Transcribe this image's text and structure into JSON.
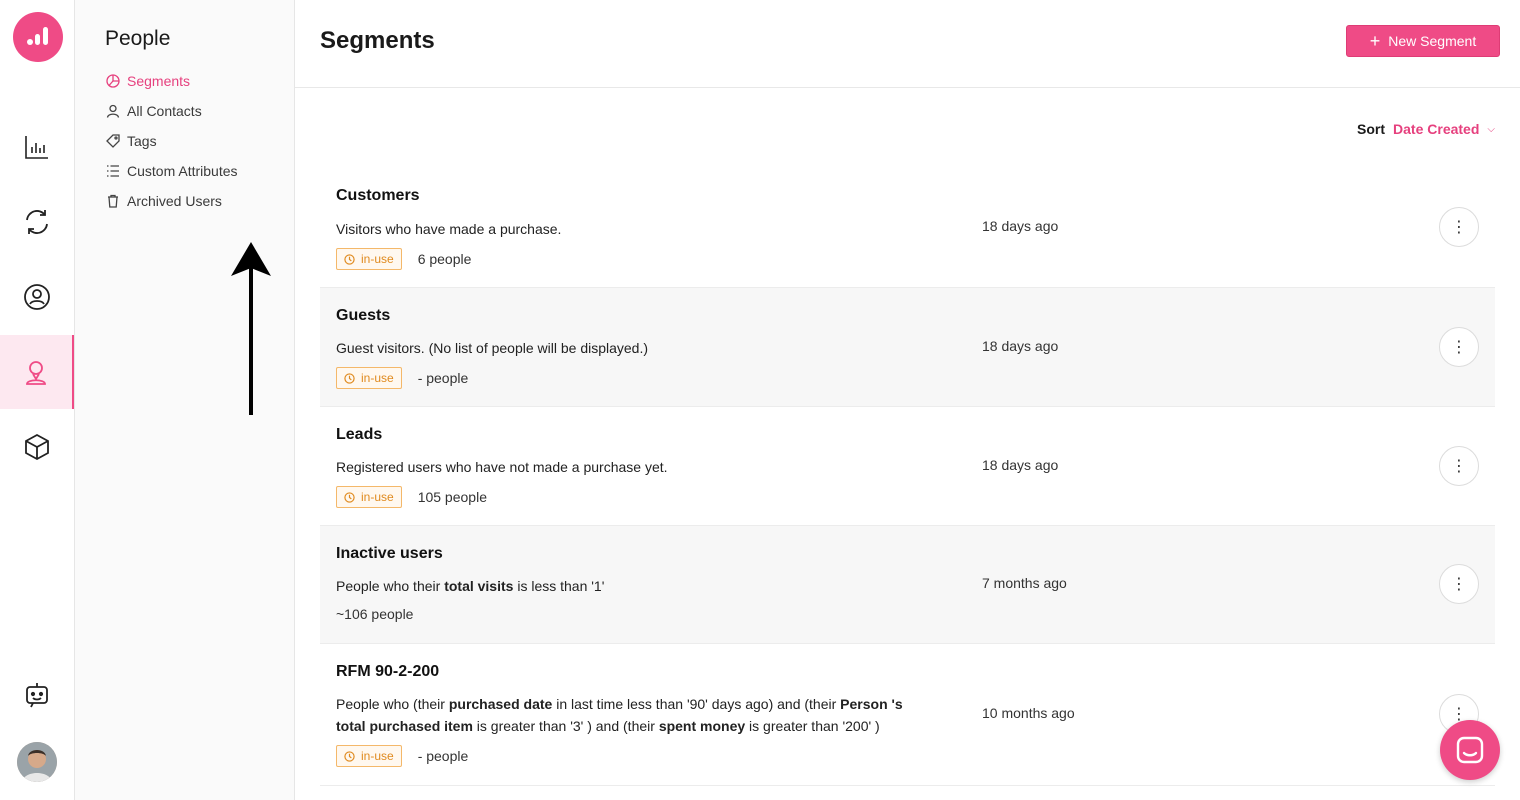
{
  "brand": {
    "accent": "#ef4b86",
    "accent_text": "#e6407e",
    "badge_color": "#e08a1e"
  },
  "rail": {
    "items": [
      {
        "icon": "bar-chart-icon"
      },
      {
        "icon": "refresh-icon"
      },
      {
        "icon": "user-circle-icon"
      },
      {
        "icon": "person-location-icon",
        "active": true
      },
      {
        "icon": "cube-icon"
      }
    ],
    "bottom": [
      {
        "icon": "bot-icon"
      },
      {
        "icon": "avatar"
      }
    ]
  },
  "subnav": {
    "title": "People",
    "items": [
      {
        "label": "Segments",
        "icon": "pie-chart-icon",
        "active": true
      },
      {
        "label": "All Contacts",
        "icon": "user-icon"
      },
      {
        "label": "Tags",
        "icon": "tag-icon"
      },
      {
        "label": "Custom Attributes",
        "icon": "list-icon"
      },
      {
        "label": "Archived Users",
        "icon": "trash-icon"
      }
    ]
  },
  "main": {
    "title": "Segments",
    "new_button": "New Segment",
    "sort_label": "Sort",
    "sort_value": "Date Created"
  },
  "segments": [
    {
      "name": "Customers",
      "desc_html": "Visitors who have made a purchase.",
      "badge": "in-use",
      "people": "6 people",
      "date": "18 days ago"
    },
    {
      "name": "Guests",
      "desc_html": "Guest visitors. (No list of people will be displayed.)",
      "badge": "in-use",
      "people": "- people",
      "date": "18 days ago"
    },
    {
      "name": "Leads",
      "desc_html": "Registered users who have not made a purchase yet.",
      "badge": "in-use",
      "people": "105 people",
      "date": "18 days ago"
    },
    {
      "name": "Inactive users",
      "desc_html": "People who their <b>total visits</b> is less than '1'",
      "badge": "",
      "people": "~106 people",
      "date": "7 months ago"
    },
    {
      "name": "RFM 90-2-200",
      "desc_html": "People who (their <b>purchased date</b> in last time less than '90' days ago) and (their <b>Person 's total purchased item</b> is greater than '3' ) and (their <b>spent money</b> is greater than '200' )",
      "badge": "in-use",
      "people": "- people",
      "date": "10 months ago"
    }
  ]
}
